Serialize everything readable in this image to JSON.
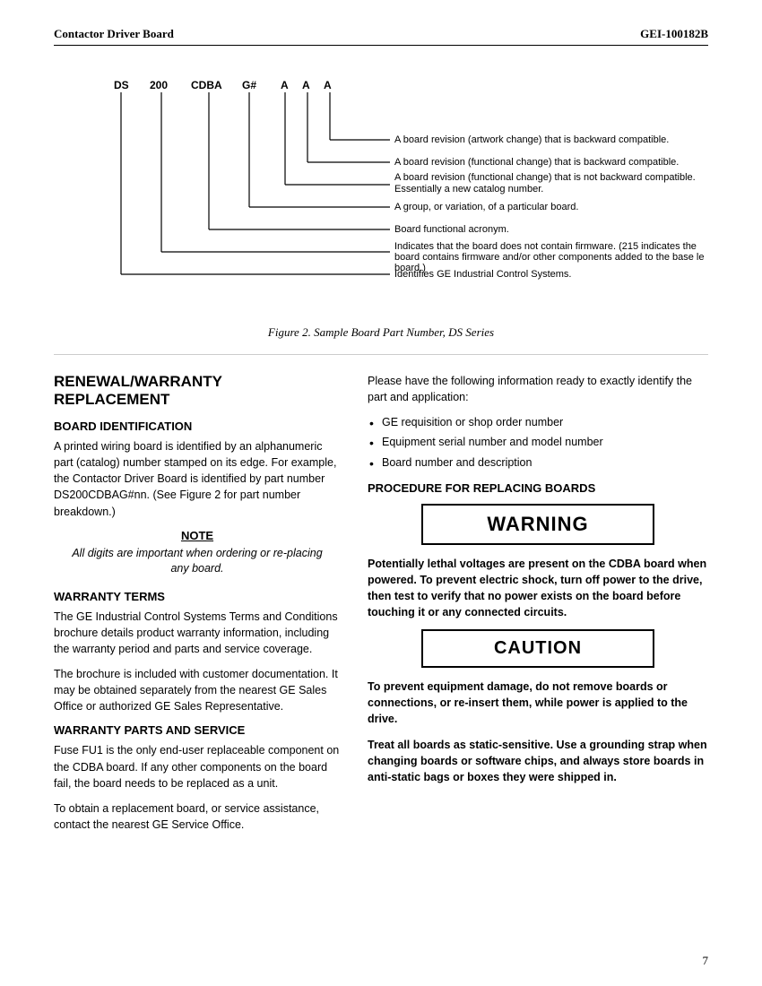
{
  "header": {
    "left": "Contactor Driver Board",
    "right": "GEI-100182B"
  },
  "diagram": {
    "caption": "Figure 2.  Sample Board Part Number, DS Series",
    "labels": {
      "ds": "DS",
      "num": "200",
      "cdba": "CDBA",
      "gnum": "G#",
      "a1": "A",
      "a2": "A",
      "a3": "A",
      "line1": "A board revision (artwork change) that is backward compatible.",
      "line2": "A board revision (functional change) that is backward compatible.",
      "line3": "A board revision (functional change) that is not backward compatible. Essentially a new catalog number.",
      "line4": "A group, or variation, of a particular board.",
      "line5": "Board functional acronym.",
      "line6": "Indicates that the board does not contain firmware. (215 indicates the board contains firmware and/or other components added to the base level board.)",
      "line7": "Identifies GE Industrial Control Systems."
    }
  },
  "renewal_warranty": {
    "title": "RENEWAL/WARRANTY REPLACEMENT",
    "board_id": {
      "title": "BOARD IDENTIFICATION",
      "text": "A printed wiring board is identified by an alphanumeric part (catalog) number stamped on its edge. For example, the Contactor Driver Board is identified by part number DS200CDBAG#nn. (See Figure 2 for part number breakdown.)"
    },
    "note": {
      "label": "NOTE",
      "text": "All digits are important when ordering or re-placing any board."
    },
    "warranty_terms": {
      "title": "WARRANTY TERMS",
      "para1": "The GE Industrial Control Systems Terms and Conditions brochure details product warranty information, including the warranty period and parts and service coverage.",
      "para2": "The brochure is included with customer documentation. It may be obtained separately from the nearest GE Sales Office or authorized GE Sales Representative."
    },
    "warranty_parts": {
      "title": "WARRANTY PARTS AND SERVICE",
      "para1": "Fuse FU1 is the only end-user replaceable component on the CDBA board. If any other components on the board fail, the board needs to be replaced as a unit.",
      "para2": "To obtain a replacement board, or service assistance, contact the nearest GE Service Office."
    }
  },
  "right_column": {
    "intro": "Please have the following information ready to exactly identify the part and application:",
    "bullets": [
      "GE requisition or shop order number",
      "Equipment serial number and model number",
      "Board number and description"
    ],
    "procedure": {
      "title": "PROCEDURE FOR REPLACING BOARDS",
      "warning_label": "WARNING",
      "warning_text": "Potentially lethal voltages are present on the CDBA board when powered. To prevent electric shock, turn off power to the drive, then test to verify that no power exists on the board before touching it or any connected circuits.",
      "caution_label": "CAUTION",
      "caution_para1": "To prevent equipment damage, do not remove boards or connections, or re-insert them, while power is applied to the drive.",
      "caution_para2": "Treat all boards as static-sensitive. Use a grounding strap when changing boards or software chips, and always store boards in anti-static bags or boxes they were shipped in."
    }
  },
  "page_number": "7"
}
